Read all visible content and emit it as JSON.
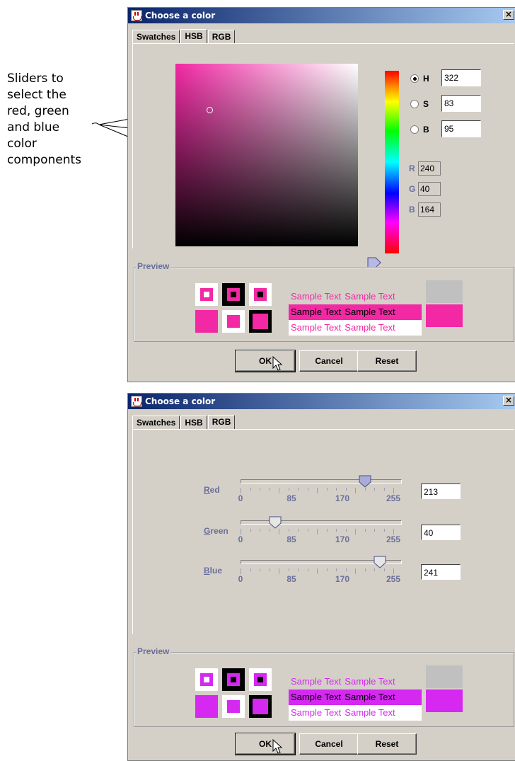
{
  "annotation": {
    "lines": [
      "Sliders to",
      "select the",
      "red, green",
      "and blue",
      "color",
      "components"
    ]
  },
  "dialog_hsb": {
    "title": "Choose a color",
    "close_glyph": "×",
    "tabs": [
      "Swatches",
      "HSB",
      "RGB"
    ],
    "active_tab": "HSB",
    "hsb": {
      "selected": "H",
      "rows": [
        {
          "label": "H",
          "value": "322"
        },
        {
          "label": "S",
          "value": "83"
        },
        {
          "label": "B",
          "value": "95"
        }
      ]
    },
    "rgb_readout": [
      {
        "label": "R",
        "value": "240"
      },
      {
        "label": "G",
        "value": "40"
      },
      {
        "label": "B",
        "value": "164"
      }
    ],
    "preview": {
      "title": "Preview",
      "color": "#f228a4",
      "sample_text": [
        "Sample Text",
        "Sample Text"
      ]
    },
    "buttons": {
      "ok": "OK",
      "cancel": "Cancel",
      "reset": "Reset"
    }
  },
  "dialog_rgb": {
    "title": "Choose a color",
    "close_glyph": "×",
    "tabs": [
      "Swatches",
      "HSB",
      "RGB"
    ],
    "active_tab": "RGB",
    "sliders": [
      {
        "label_mnemonic": "R",
        "label_rest": "ed",
        "value": "213",
        "fraction": 0.835
      },
      {
        "label_mnemonic": "G",
        "label_rest": "reen",
        "value": "40",
        "fraction": 0.157
      },
      {
        "label_mnemonic": "B",
        "label_rest": "lue",
        "value": "241",
        "fraction": 0.945
      }
    ],
    "tick_labels": [
      "0",
      "85",
      "170",
      "255"
    ],
    "preview": {
      "title": "Preview",
      "color": "#d528f1",
      "sample_text": [
        "Sample Text",
        "Sample Text"
      ]
    },
    "buttons": {
      "ok": "OK",
      "cancel": "Cancel",
      "reset": "Reset"
    }
  }
}
